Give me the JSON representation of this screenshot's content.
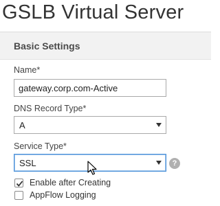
{
  "page": {
    "title": "GSLB Virtual Server"
  },
  "panel": {
    "title": "Basic Settings"
  },
  "fields": {
    "name": {
      "label": "Name*",
      "value": "gateway.corp.com-Active"
    },
    "dns_record_type": {
      "label": "DNS Record Type*",
      "value": "A"
    },
    "service_type": {
      "label": "Service Type*",
      "value": "SSL"
    }
  },
  "help_icon": {
    "glyph": "?"
  },
  "checkboxes": [
    {
      "label": "Enable after Creating",
      "checked": true
    },
    {
      "label": "AppFlow Logging",
      "checked": false
    }
  ]
}
